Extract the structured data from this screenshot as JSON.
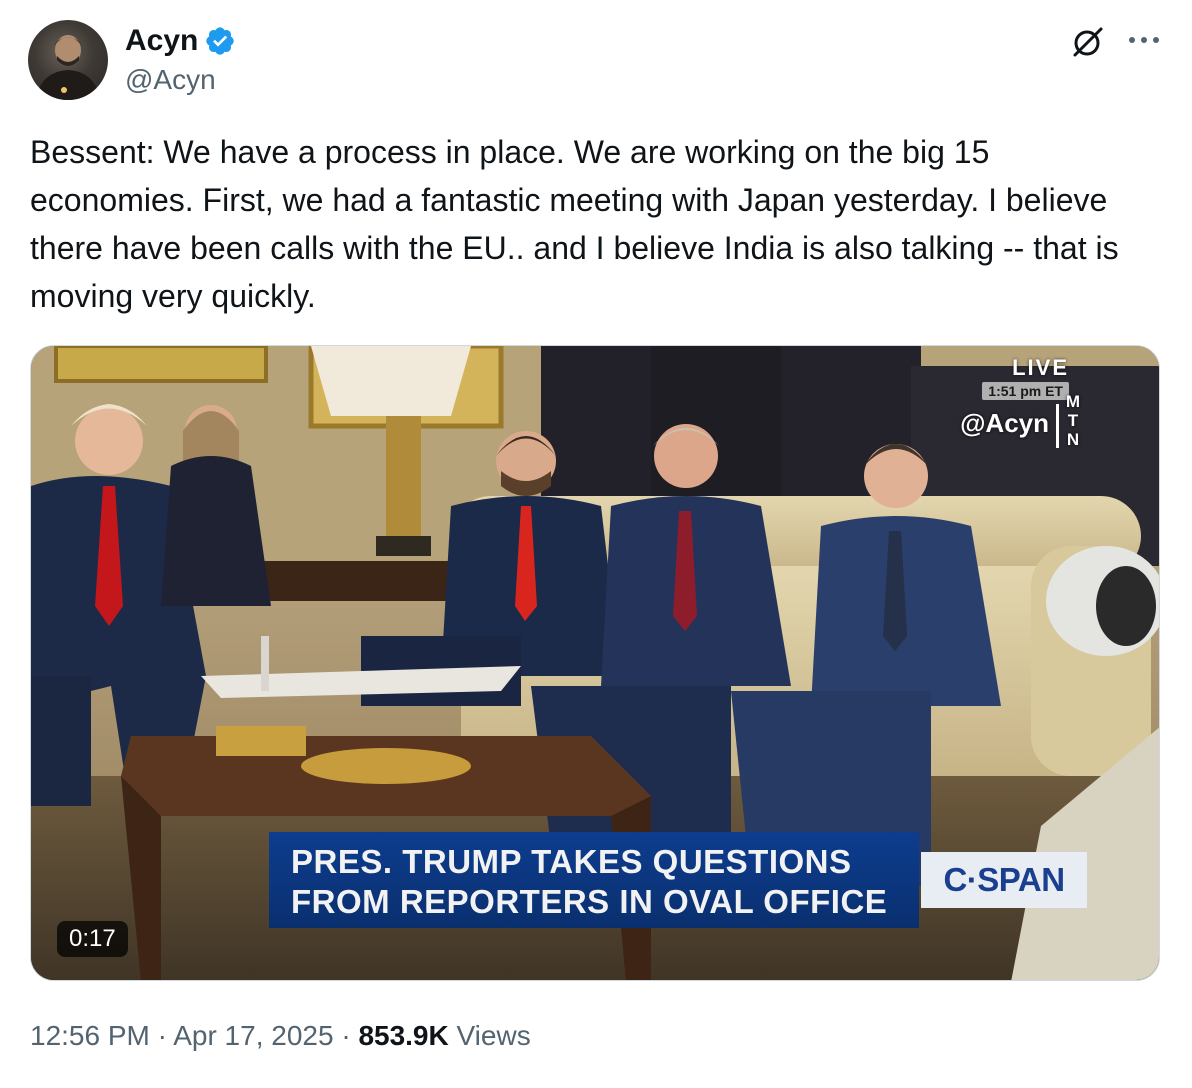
{
  "author": {
    "display_name": "Acyn",
    "handle": "@Acyn",
    "verified": true,
    "verified_color": "#1d9bf0"
  },
  "tweet": {
    "text": "Bessent: We have a process in place. We are working on the big 15 economies. First, we had a fantastic meeting with Japan yesterday. I believe there have been calls with the EU.. and I believe India is also talking -- that is moving very quickly."
  },
  "video": {
    "duration": "0:17",
    "live_label": "LIVE",
    "live_time": "1:51 pm ET",
    "watermark": "@Acyn",
    "mtn_letters": [
      "M",
      "T",
      "N"
    ],
    "chyron_line1": "PRES. TRUMP TAKES QUESTIONS",
    "chyron_line2": "FROM REPORTERS IN OVAL OFFICE",
    "network": "C·SPAN",
    "chyron_color": "#0d3d8f"
  },
  "meta": {
    "time": "12:56 PM",
    "separator": " · ",
    "date": "Apr 17, 2025",
    "views_count": "853.9K",
    "views_label": " Views"
  },
  "icons": {
    "grok": "grok-icon",
    "more": "more-icon",
    "verified": "verified-badge-icon"
  }
}
